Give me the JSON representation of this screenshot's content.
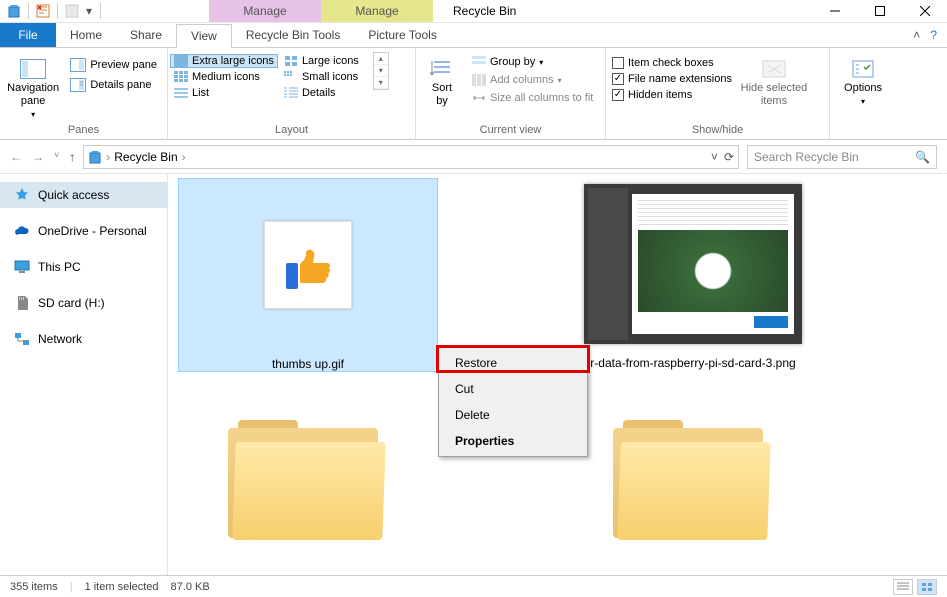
{
  "title": "Recycle Bin",
  "manage_tabs": {
    "purple": "Manage",
    "yellow": "Manage"
  },
  "tabs": {
    "file": "File",
    "home": "Home",
    "share": "Share",
    "view": "View",
    "rbtools": "Recycle Bin Tools",
    "pictools": "Picture Tools"
  },
  "ribbon": {
    "panes": {
      "nav": "Navigation\npane",
      "preview": "Preview pane",
      "details": "Details pane",
      "label": "Panes"
    },
    "layout": {
      "xl": "Extra large icons",
      "large": "Large icons",
      "medium": "Medium icons",
      "small": "Small icons",
      "list": "List",
      "details": "Details",
      "label": "Layout"
    },
    "curview": {
      "sortby": "Sort\nby",
      "groupby": "Group by",
      "addcols": "Add columns",
      "sizecols": "Size all columns to fit",
      "label": "Current view"
    },
    "showhide": {
      "itemcb": "Item check boxes",
      "ext": "File name extensions",
      "hidden": "Hidden items",
      "hidesel": "Hide selected\nitems",
      "checked": {
        "itemcb": false,
        "ext": true,
        "hidden": true
      },
      "label": "Show/hide"
    },
    "options": "Options"
  },
  "breadcrumb": {
    "location": "Recycle Bin"
  },
  "search": {
    "placeholder": "Search Recycle Bin"
  },
  "sidebar": {
    "items": [
      {
        "label": "Quick access",
        "icon": "star"
      },
      {
        "label": "OneDrive - Personal",
        "icon": "cloud"
      },
      {
        "label": "This PC",
        "icon": "pc"
      },
      {
        "label": "SD card (H:)",
        "icon": "sd"
      },
      {
        "label": "Network",
        "icon": "network"
      }
    ]
  },
  "files": {
    "selected": "thumbs up.gif",
    "png": "r-data-from-raspberry-pi-sd-card-3.png"
  },
  "context_menu": {
    "restore": "Restore",
    "cut": "Cut",
    "delete": "Delete",
    "properties": "Properties"
  },
  "statusbar": {
    "count": "355 items",
    "selection": "1 item selected",
    "size": "87.0 KB"
  }
}
